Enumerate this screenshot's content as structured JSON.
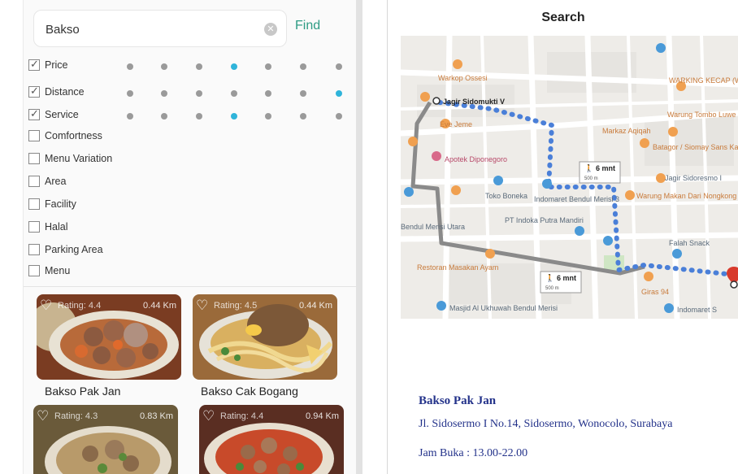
{
  "search": {
    "value": "Bakso",
    "find_label": "Find"
  },
  "filters": [
    {
      "label": "Price",
      "checked": true,
      "active_dot": 3
    },
    {
      "label": "Distance",
      "checked": true,
      "active_dot": 6
    },
    {
      "label": "Service",
      "checked": true,
      "active_dot": 3
    },
    {
      "label": "Comfortness",
      "checked": false
    },
    {
      "label": "Menu Variation",
      "checked": false
    },
    {
      "label": "Area",
      "checked": false
    },
    {
      "label": "Facility",
      "checked": false
    },
    {
      "label": "Halal",
      "checked": false
    },
    {
      "label": "Parking Area",
      "checked": false
    },
    {
      "label": "Menu",
      "checked": false
    }
  ],
  "cards": [
    {
      "name": "Bakso Pak Jan",
      "rating": "Rating: 4.4",
      "distance": "0.44 Km"
    },
    {
      "name": "Bakso Cak Bogang",
      "rating": "Rating: 4.5",
      "distance": "0.44 Km"
    },
    {
      "name": "",
      "rating": "Rating: 4.3",
      "distance": "0.83 Km"
    },
    {
      "name": "",
      "rating": "Rating: 4.4",
      "distance": "0.94 Km"
    }
  ],
  "detail": {
    "title": "Search",
    "name": "Bakso Pak Jan",
    "address": "Jl. Sidosermo I No.14, Sidosermo, Wonocolo, Surabaya",
    "hours": "Jam Buka : 13.00-22.00"
  },
  "map": {
    "labels": {
      "start": "Jagir Sidomukti V",
      "walk_time": "6 mnt",
      "walk_dist": "500 m",
      "warkop": "Warkop Ossesi",
      "toko": "Toko Boneka",
      "indomaret": "Indomaret Bendul Merisi 3",
      "pt": "PT Indoka Putra Mandiri",
      "apotek": "Apotek Diponegoro",
      "restoran": "Restoran Masakan Ayam",
      "masjid": "Masjid Al Ukhuwah Bendul Merisi",
      "falah": "Falah Snack",
      "warung_tombo": "Warung Tombo Luwe",
      "markaz": "Markaz Aqiqah",
      "batagor": "Batagor / Siomay Sans Kacong Dan Pecel",
      "warung_makan": "Warung Makan Dari Nongkong El",
      "giras": "Giras 94",
      "indomaret2": "Indomaret S",
      "jagir_sidoresmo": "Jagir Sidoresmo I",
      "warking": "WARKING KECAP (WARKO",
      "bendul": "Bendul Merisi Utara",
      "eve": "Eve Jeme"
    }
  },
  "colors": {
    "accent": "#2e9c84",
    "active_dot": "#2fb4da",
    "route": "#4a7fd8",
    "info_text": "#23328a"
  }
}
